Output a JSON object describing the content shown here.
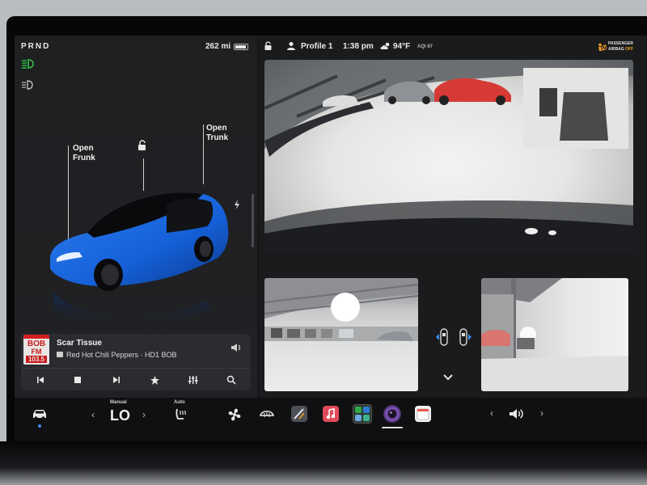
{
  "status_left": {
    "gear": "PRND",
    "range": "262 mi",
    "battery_level": 0.8
  },
  "car": {
    "open_frunk": "Open\nFrunk",
    "open_trunk": "Open\nTrunk",
    "paint_color": "#1560d8"
  },
  "status_right": {
    "profile": "Profile 1",
    "time": "1:38 pm",
    "temperature": "94°F",
    "aqi": "AQI 67",
    "passenger_airbag_line1": "PASSENGER",
    "passenger_airbag_line2": "AIRBAG",
    "passenger_airbag_state": "OFF"
  },
  "media": {
    "station_logo_line1": "BOB",
    "station_logo_line2": "FM",
    "station_logo_line3": "103.5",
    "song": "Scar Tissue",
    "artist": "Red Hot Chili Peppers · HD1 BOB"
  },
  "climate": {
    "fan_mode": "Manual",
    "temperature": "LO",
    "seat_mode": "Auto"
  },
  "colors": {
    "accent_blue": "#3d8ef0",
    "indicator_green": "#35c24a",
    "airbag_orange": "#f49f22"
  }
}
